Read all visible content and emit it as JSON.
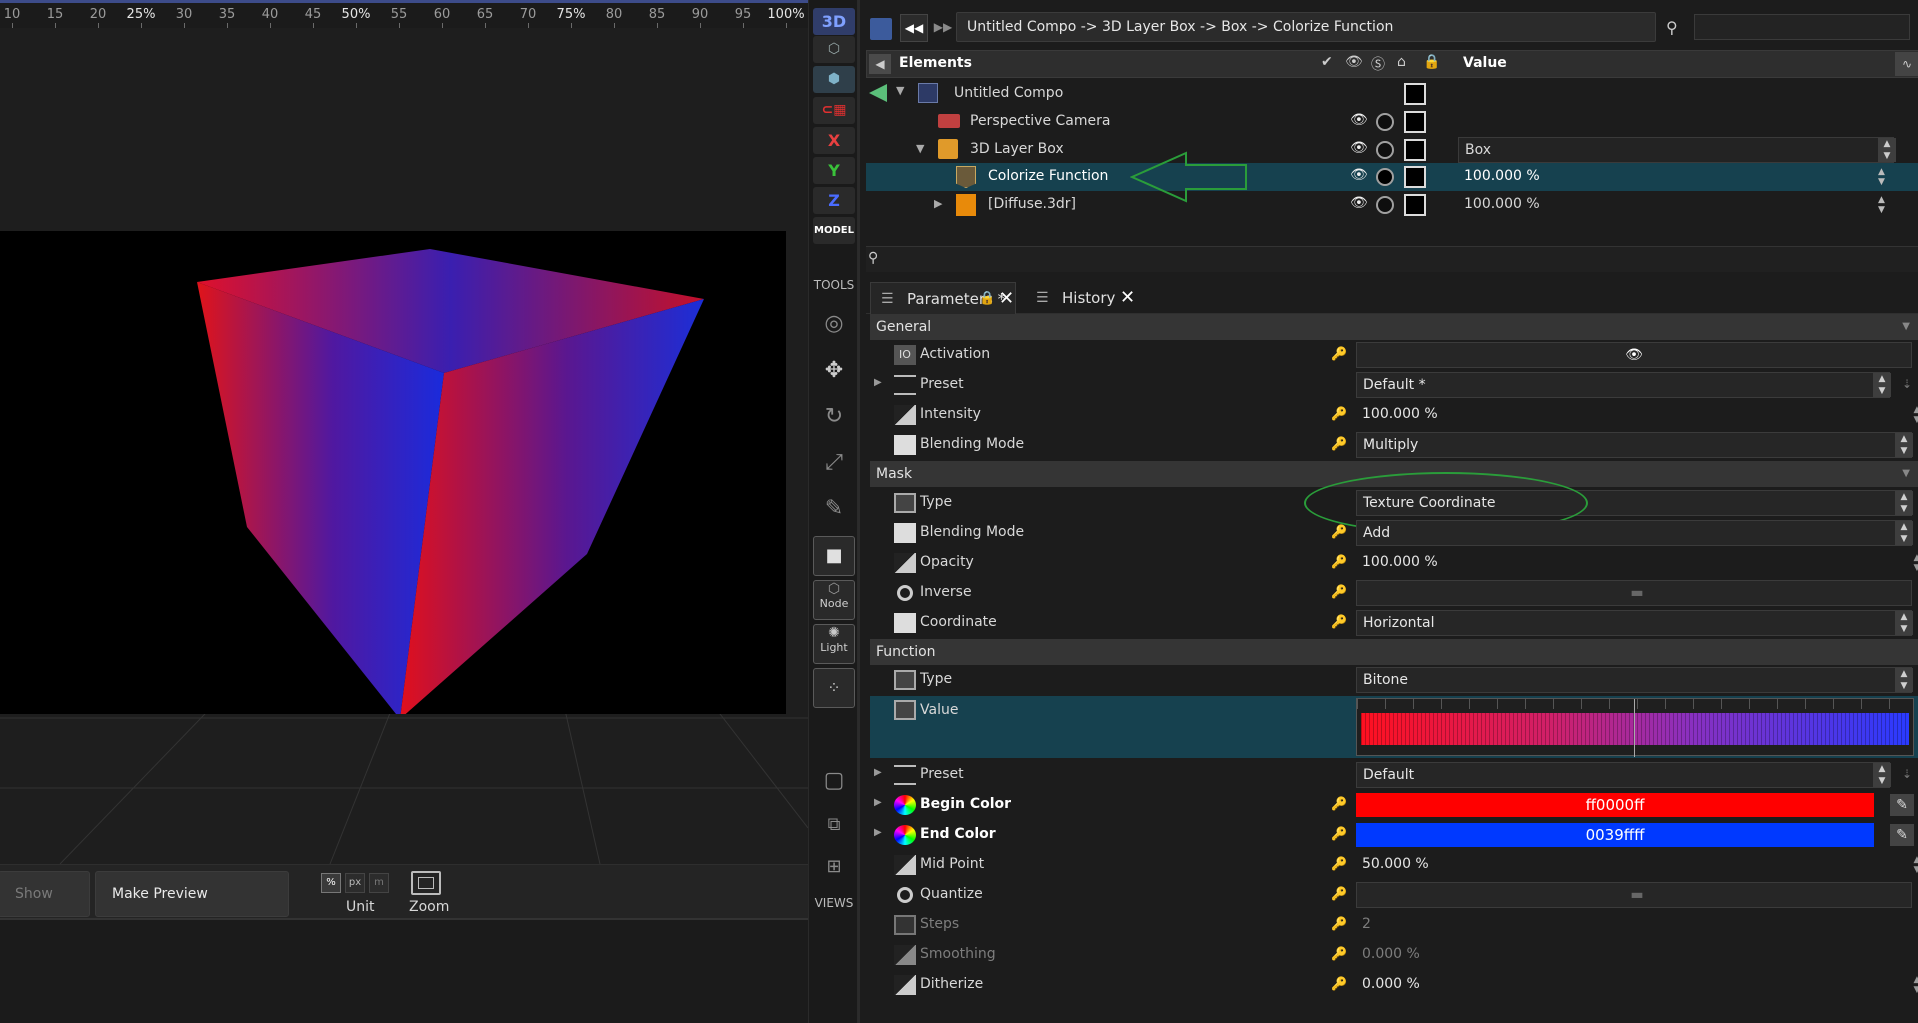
{
  "ruler": {
    "ticks": [
      {
        "label": "10",
        "pct": false
      },
      {
        "label": "15",
        "pct": false
      },
      {
        "label": "20",
        "pct": false
      },
      {
        "label": "25%",
        "pct": true
      },
      {
        "label": "30",
        "pct": false
      },
      {
        "label": "35",
        "pct": false
      },
      {
        "label": "40",
        "pct": false
      },
      {
        "label": "45",
        "pct": false
      },
      {
        "label": "50%",
        "pct": true
      },
      {
        "label": "55",
        "pct": false
      },
      {
        "label": "60",
        "pct": false
      },
      {
        "label": "65",
        "pct": false
      },
      {
        "label": "70",
        "pct": false
      },
      {
        "label": "75%",
        "pct": true
      },
      {
        "label": "80",
        "pct": false
      },
      {
        "label": "85",
        "pct": false
      },
      {
        "label": "90",
        "pct": false
      },
      {
        "label": "95",
        "pct": false
      },
      {
        "label": "100%",
        "pct": true
      }
    ]
  },
  "viewport_bar": {
    "show_grid": "Show Grid",
    "make_preview": "Make Preview Screenshot",
    "unit_label": "Unit",
    "zoom_label": "Zoom",
    "unit_opts": [
      "%",
      "px",
      "m"
    ]
  },
  "toolbar": {
    "mode_3d": "3D",
    "axis_x": "X",
    "axis_y": "Y",
    "axis_z": "Z",
    "model": "MODEL",
    "tools": "TOOLS",
    "node": "Node",
    "light": "Light",
    "views": "VIEWS"
  },
  "breadcrumb": "Untitled Compo -> 3D Layer Box -> Box -> Colorize Function",
  "elements": {
    "header": "Elements",
    "value_header": "Value",
    "rows": [
      {
        "name": "Untitled Compo",
        "value": ""
      },
      {
        "name": "Perspective Camera",
        "value": ""
      },
      {
        "name": "3D Layer Box",
        "value": "Box"
      },
      {
        "name": "Colorize Function",
        "value": "100.000 %"
      },
      {
        "name": "[Diffuse.3dr]",
        "value": "100.000 %"
      }
    ]
  },
  "tabs": {
    "parameters": "Parameters *",
    "history": "History"
  },
  "params": {
    "general": {
      "title": "General",
      "activation": "Activation",
      "preset": "Preset",
      "preset_val": "Default *",
      "intensity": "Intensity",
      "intensity_val": "100.000 %",
      "blending": "Blending Mode",
      "blending_val": "Multiply"
    },
    "mask": {
      "title": "Mask",
      "type": "Type",
      "type_val": "Texture Coordinate",
      "blending": "Blending Mode",
      "blending_val": "Add",
      "opacity": "Opacity",
      "opacity_val": "100.000 %",
      "inverse": "Inverse",
      "coordinate": "Coordinate",
      "coordinate_val": "Horizontal"
    },
    "function": {
      "title": "Function",
      "type": "Type",
      "type_val": "Bitone",
      "value": "Value",
      "preset": "Preset",
      "preset_val": "Default",
      "begin": "Begin Color",
      "begin_val": "ff0000ff",
      "end": "End Color",
      "end_val": "0039ffff",
      "mid": "Mid Point",
      "mid_val": "50.000 %",
      "quantize": "Quantize",
      "steps": "Steps",
      "steps_val": "2",
      "smoothing": "Smoothing",
      "smoothing_val": "0.000 %",
      "ditherize": "Ditherize",
      "ditherize_val": "0.000 %"
    }
  },
  "colors": {
    "accent": "#16414f",
    "begin": "#ff0000",
    "end": "#0039ff",
    "annotation": "#2a9d3a"
  }
}
